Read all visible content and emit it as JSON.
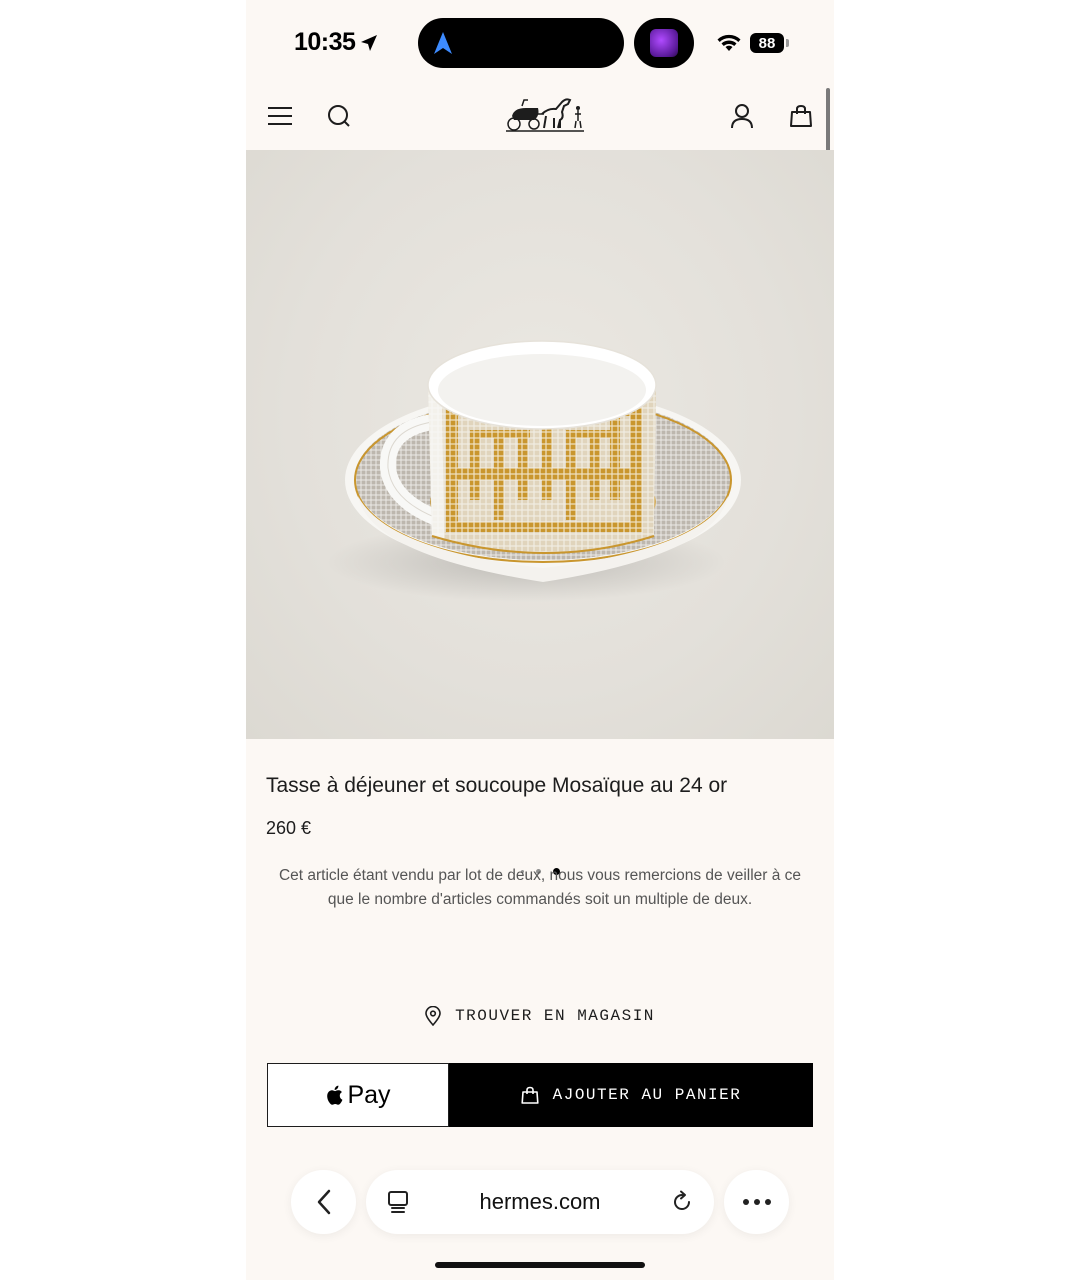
{
  "status_bar": {
    "time": "10:35",
    "battery": "88"
  },
  "header": {
    "brand": "Hermès"
  },
  "product": {
    "title": "Tasse à déjeuner et soucoupe Mosaïque au 24 or",
    "price": "260 €",
    "note": "Cet article étant vendu par lot de deux, nous vous remercions de veiller à ce que le nombre d'articles commandés soit un multiple de deux.",
    "image_count": 3,
    "active_image": 3
  },
  "actions": {
    "find_store": "TROUVER EN MAGASIN",
    "apple_pay": "Pay",
    "add_to_cart": "AJOUTER AU PANIER"
  },
  "browser": {
    "url": "hermes.com"
  },
  "colors": {
    "page_bg": "#fcf8f4",
    "gold": "#c9962e",
    "black": "#000000"
  },
  "icons": [
    "location-arrow-icon",
    "navigation-icon",
    "wifi-icon",
    "menu-icon",
    "search-icon",
    "account-icon",
    "bag-icon",
    "location-pin-icon",
    "apple-logo-icon",
    "back-icon",
    "tabs-icon",
    "reload-icon",
    "more-icon"
  ]
}
